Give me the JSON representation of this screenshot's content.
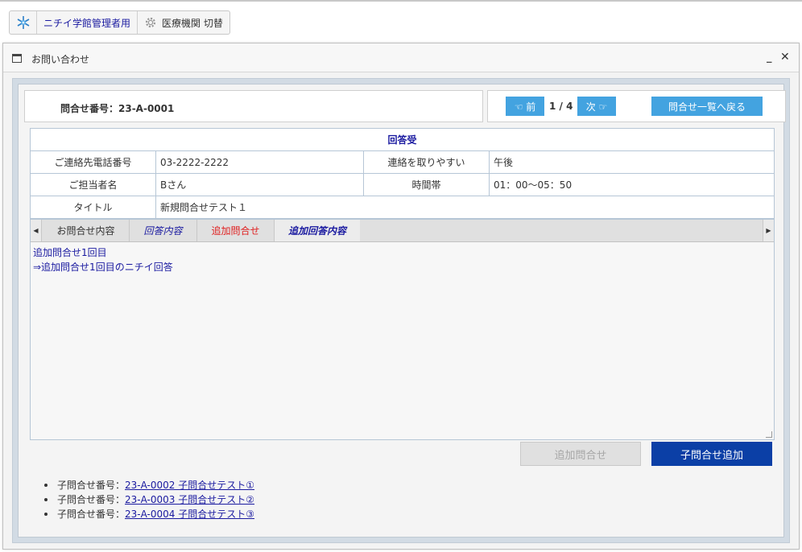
{
  "toolbar": {
    "admin_label": "ニチイ学館管理者用",
    "switch_label": "医療機関 切替"
  },
  "window": {
    "title": "お問い合わせ",
    "minimize": "_",
    "close": "✕"
  },
  "inquiry": {
    "number_label": "問合せ番号：23-A-0001"
  },
  "nav": {
    "prev_label": "☜ 前",
    "page": "1 / 4",
    "next_label": "次 ☞",
    "back_label": "問合せ一覧へ戻る"
  },
  "detail": {
    "header": "回答受",
    "phone_label": "ご連絡先電話番号",
    "phone_value": "03-2222-2222",
    "contact_time_label": "連絡を取りやすい",
    "contact_time_value": "午後",
    "person_label": "ご担当者名",
    "person_value": "Bさん",
    "timeslot_label": "時間帯",
    "timeslot_value": "01：00～05：50",
    "title_label": "タイトル",
    "title_value": "新規問合せテスト１"
  },
  "tabs": [
    {
      "label": "お問合せ内容"
    },
    {
      "label": "回答内容"
    },
    {
      "label": "追加問合せ"
    },
    {
      "label": "追加回答内容"
    }
  ],
  "tab_content": {
    "line1": "追加問合せ1回目",
    "line2": "⇒追加問合せ1回目のニチイ回答"
  },
  "buttons": {
    "add_inquiry": "追加問合せ",
    "add_child": "子問合せ追加"
  },
  "children": [
    {
      "prefix": "子問合せ番号：",
      "link": "23-A-0002 子問合せテスト①"
    },
    {
      "prefix": "子問合せ番号：",
      "link": "23-A-0003 子問合せテスト②"
    },
    {
      "prefix": "子問合せ番号：",
      "link": "23-A-0004 子問合せテスト③"
    }
  ],
  "colors": {
    "nav_button": "#43a3e0",
    "primary_button": "#0b3fa6",
    "link": "#1a1aa0",
    "tab_red": "#e02020"
  },
  "icons": {
    "logo": "snowflake-logo-icon",
    "settings": "gear-icon",
    "window": "window-icon"
  }
}
